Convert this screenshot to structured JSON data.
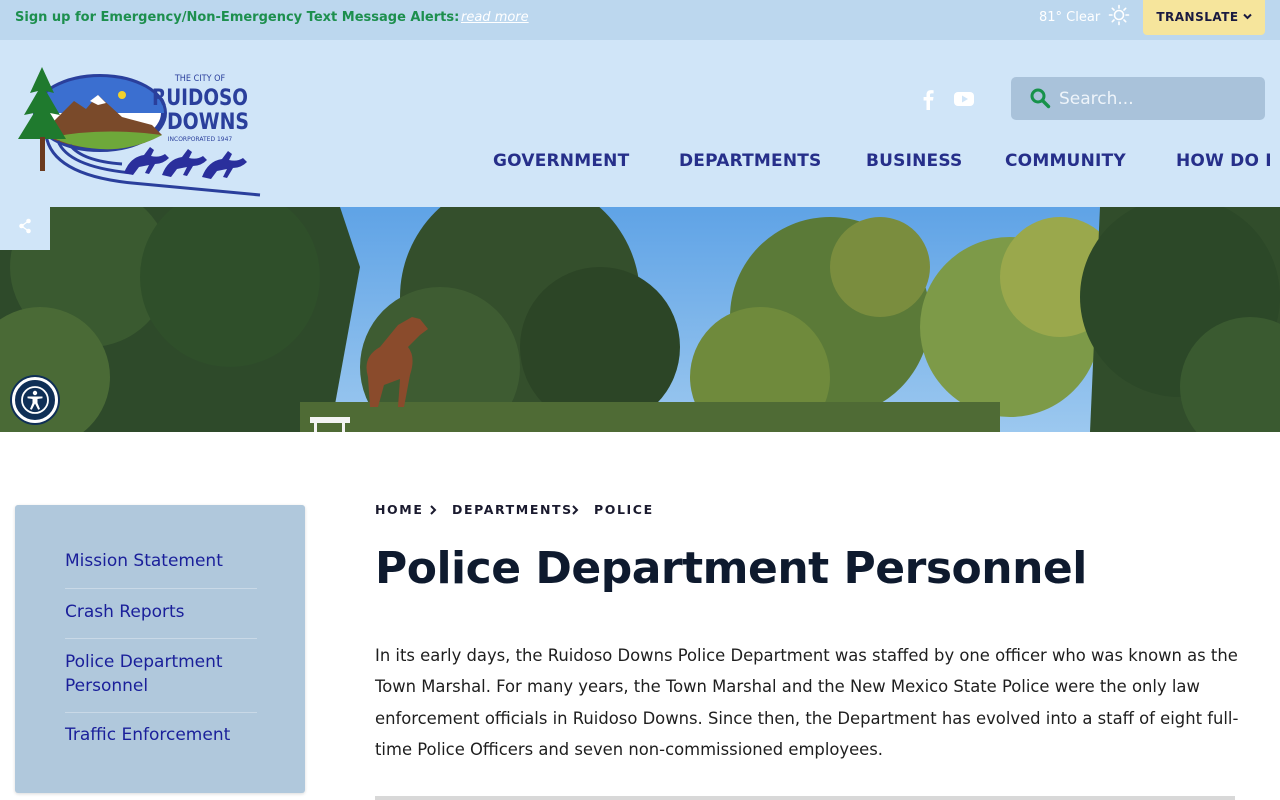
{
  "alert": {
    "text": "Sign up for Emergency/Non-Emergency Text Message Alerts:",
    "link": "read more"
  },
  "weather": {
    "text": "81° Clear",
    "icon": "sun-icon"
  },
  "translate": {
    "label": "TRANSLATE",
    "icon": "chevron-down-icon"
  },
  "logo": {
    "line1": "THE CITY OF",
    "line2": "RUIDOSO",
    "line3": "DOWNS",
    "line4": "INCORPORATED 1947"
  },
  "social": [
    {
      "name": "facebook",
      "icon": "facebook-icon"
    },
    {
      "name": "youtube",
      "icon": "youtube-icon"
    }
  ],
  "search": {
    "placeholder": "Search..."
  },
  "nav": [
    {
      "label": "GOVERNMENT"
    },
    {
      "label": "DEPARTMENTS"
    },
    {
      "label": "BUSINESS"
    },
    {
      "label": "COMMUNITY"
    },
    {
      "label": "HOW DO I"
    }
  ],
  "sidebar": {
    "items": [
      {
        "label": "Mission Statement"
      },
      {
        "label": "Crash Reports"
      },
      {
        "label": "Police Department Personnel"
      },
      {
        "label": "Traffic Enforcement"
      }
    ]
  },
  "breadcrumb": [
    {
      "label": "HOME"
    },
    {
      "label": "DEPARTMENTS"
    },
    {
      "label": "POLICE"
    }
  ],
  "page": {
    "title": "Police Department Personnel",
    "paragraph": "In its early days, the Ruidoso Downs Police Department was staffed by one officer who was known as the Town Marshal. For many years, the Town Marshal and the New Mexico State Police were the only law enforcement officials in Ruidoso Downs. Since then, the Department has evolved into a staff of eight full-time Police Officers and seven non-commissioned employees."
  },
  "colors": {
    "alert_text": "#1d8f4e",
    "nav": "#262f8a",
    "header_bg": "#d0e5f8",
    "translate_bg": "#f6e59c",
    "sidebar_bg": "#b0c8dc",
    "sidebar_link": "#1a1f9a"
  }
}
